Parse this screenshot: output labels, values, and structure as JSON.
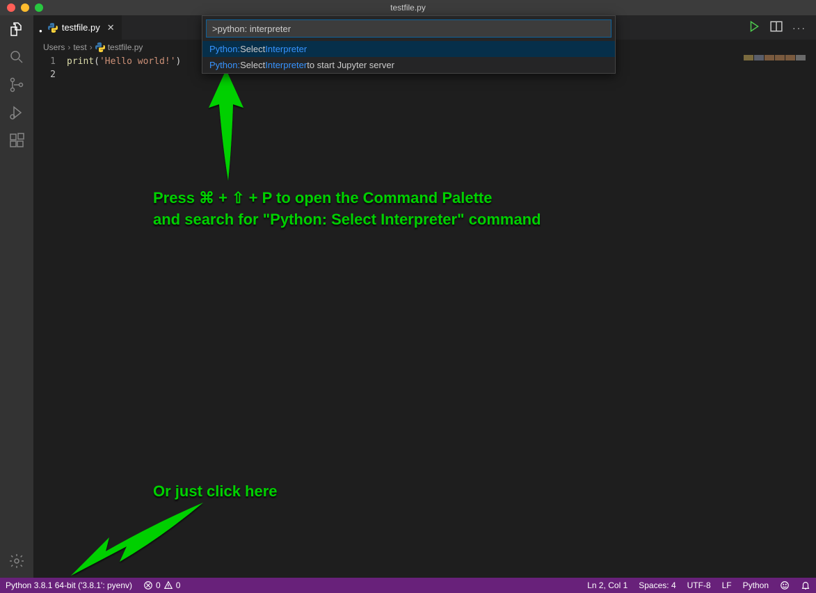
{
  "titlebar": {
    "title": "testfile.py"
  },
  "tab": {
    "name": "testfile.py",
    "modified": true
  },
  "breadcrumbs": {
    "p1": "Users",
    "p2": "test",
    "file": "testfile.py"
  },
  "editor": {
    "lines": [
      "1",
      "2"
    ],
    "code_fn": "print",
    "code_str": "'Hello world!'"
  },
  "cmdpalette": {
    "input": ">python: interpreter",
    "item1": {
      "prefix": "Python:",
      "mid": " Select ",
      "hl": "Interpreter",
      "suffix": ""
    },
    "item2": {
      "prefix": "Python:",
      "mid": " Select ",
      "hl": "Interpreter",
      "suffix": " to start Jupyter server"
    }
  },
  "annotation1_l1": "Press ⌘ + ⇧ + P to open the Command Palette",
  "annotation1_l2": "and search for \"Python: Select Interpreter\" command",
  "annotation2": "Or just click here",
  "statusbar": {
    "python": "Python 3.8.1 64-bit ('3.8.1': pyenv)",
    "errors": "0",
    "warnings": "0",
    "lncol": "Ln 2, Col 1",
    "spaces": "Spaces: 4",
    "encoding": "UTF-8",
    "eol": "LF",
    "lang": "Python"
  }
}
